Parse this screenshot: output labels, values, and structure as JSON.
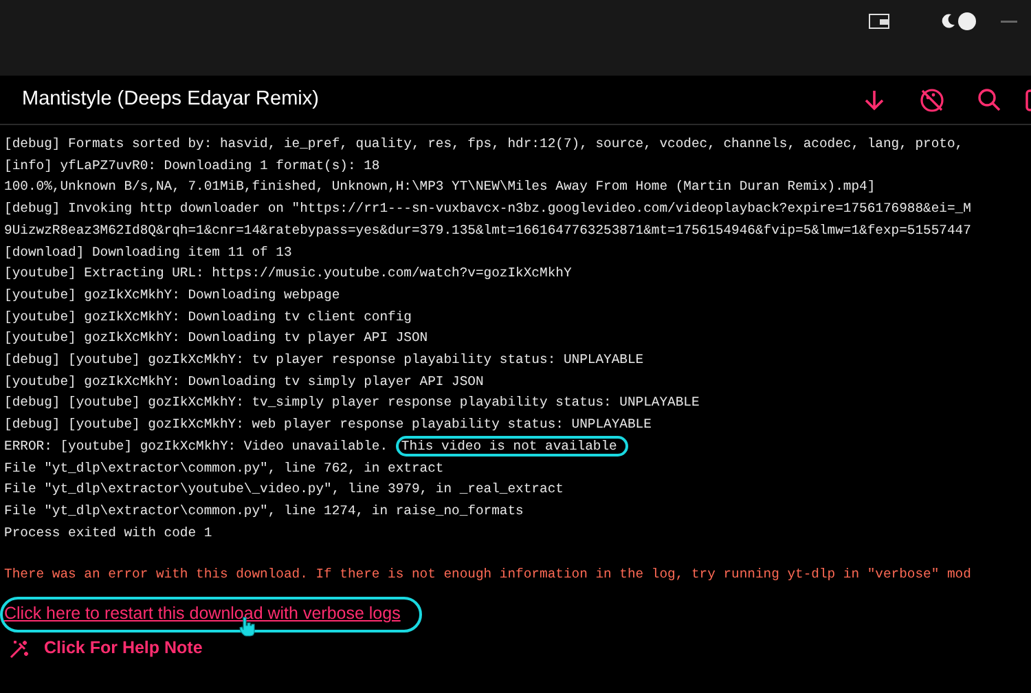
{
  "header": {
    "title": "Mantistyle (Deeps Edayar Remix)"
  },
  "log_lines": [
    {
      "text": "[debug] Formats sorted by: hasvid, ie_pref, quality, res, fps, hdr:12(7), source, vcodec, channels, acodec, lang, proto,"
    },
    {
      "text": "[info] yfLaPZ7uvR0: Downloading 1 format(s): 18"
    },
    {
      "text": "100.0%,Unknown B/s,NA, 7.01MiB,finished, Unknown,H:\\MP3 YT\\NEW\\Miles Away From Home (Martin Duran Remix).mp4]"
    },
    {
      "text": "[debug] Invoking http downloader on \"https://rr1---sn-vuxbavcx-n3bz.googlevideo.com/videoplayback?expire=1756176988&ei=_M"
    },
    {
      "text": "9UizwzR8eaz3M62Id8Q&rqh=1&cnr=14&ratebypass=yes&dur=379.135&lmt=1661647763253871&mt=1756154946&fvip=5&lmw=1&fexp=51557447"
    },
    {
      "text": "[download] Downloading item 11 of 13"
    },
    {
      "text": "[youtube] Extracting URL: https://music.youtube.com/watch?v=gozIkXcMkhY"
    },
    {
      "text": "[youtube] gozIkXcMkhY: Downloading webpage"
    },
    {
      "text": "[youtube] gozIkXcMkhY: Downloading tv client config"
    },
    {
      "text": "[youtube] gozIkXcMkhY: Downloading tv player API JSON"
    },
    {
      "text": "[debug] [youtube] gozIkXcMkhY: tv player response playability status: UNPLAYABLE"
    },
    {
      "text": "[youtube] gozIkXcMkhY: Downloading tv simply player API JSON"
    },
    {
      "text": "[debug] [youtube] gozIkXcMkhY: tv_simply player response playability status: UNPLAYABLE"
    },
    {
      "text": "[debug] [youtube] gozIkXcMkhY: web player response playability status: UNPLAYABLE"
    },
    {
      "text": "ERROR: [youtube] gozIkXcMkhY: Video unavailable.",
      "highlight": "This video is not available"
    },
    {
      "text": "File \"yt_dlp\\extractor\\common.py\", line 762, in extract"
    },
    {
      "text": "File \"yt_dlp\\extractor\\youtube\\_video.py\", line 3979, in _real_extract"
    },
    {
      "text": "File \"yt_dlp\\extractor\\common.py\", line 1274, in raise_no_formats"
    },
    {
      "text": "Process exited with code 1"
    }
  ],
  "error_notice": "There was an error with this download. If there is not enough information in the log, try running yt-dlp in \"verbose\" mod",
  "restart_link": "Click here to restart this download with verbose logs",
  "help_note": "Click For Help Note"
}
